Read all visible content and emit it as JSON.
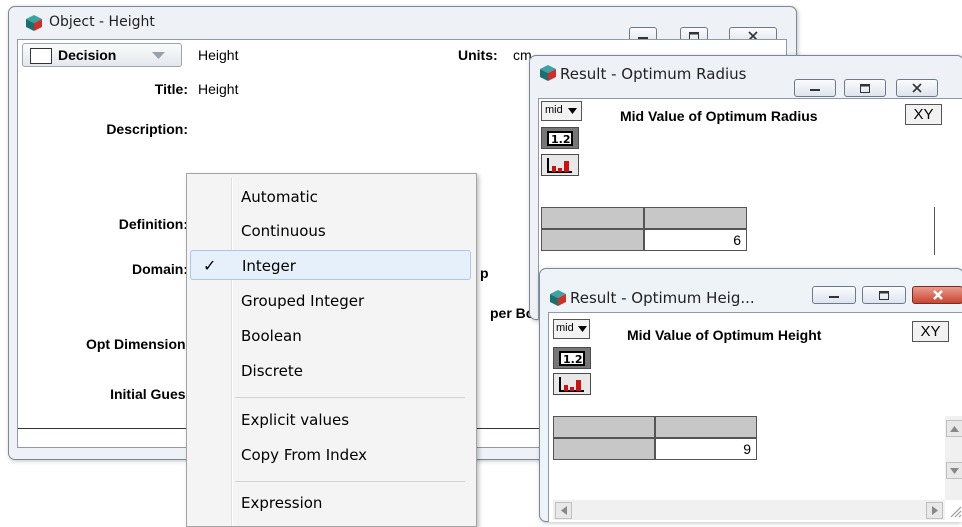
{
  "object_window": {
    "title": "Object - Height",
    "class_select": "Decision",
    "identifier": "Height",
    "units_label": "Units:",
    "units_value": "cm",
    "title_label": "Title:",
    "title_value": "Height",
    "description_label": "Description:",
    "definition_label": "Definition:",
    "domain_label": "Domain:",
    "opt_dimensions_label": "Opt Dimensions:",
    "initial_guess_label": "Initial Guess:",
    "partial_p": "p",
    "partial_upper": "per Bo"
  },
  "domain_menu": {
    "groups": [
      [
        "Automatic",
        "Continuous",
        "Integer",
        "Grouped Integer",
        "Boolean",
        "Discrete"
      ],
      [
        "Explicit values",
        "Copy From Index"
      ],
      [
        "Expression"
      ]
    ],
    "items": [
      "Automatic",
      "Continuous",
      "Integer",
      "Grouped Integer",
      "Boolean",
      "Discrete",
      "Explicit values",
      "Copy From Index",
      "Expression"
    ],
    "checked": "Integer"
  },
  "result_radius": {
    "title": "Result - Optimum Radius",
    "view_select": "mid",
    "heading": "Mid Value of Optimum Radius",
    "xy_button": "XY",
    "value": "6"
  },
  "result_height": {
    "title": "Result - Optimum Heig...",
    "view_select": "mid",
    "heading": "Mid Value of Optimum Height",
    "xy_button": "XY",
    "value": "9"
  },
  "icons": {
    "app": "analytica-cube-icon",
    "table_view": "table-view-icon",
    "graph_view": "graph-view-icon"
  },
  "colors": {
    "close_button_active": "#c9452f",
    "menu_highlight": "#e6f0fb",
    "grey_cell": "#c7c7c7"
  }
}
